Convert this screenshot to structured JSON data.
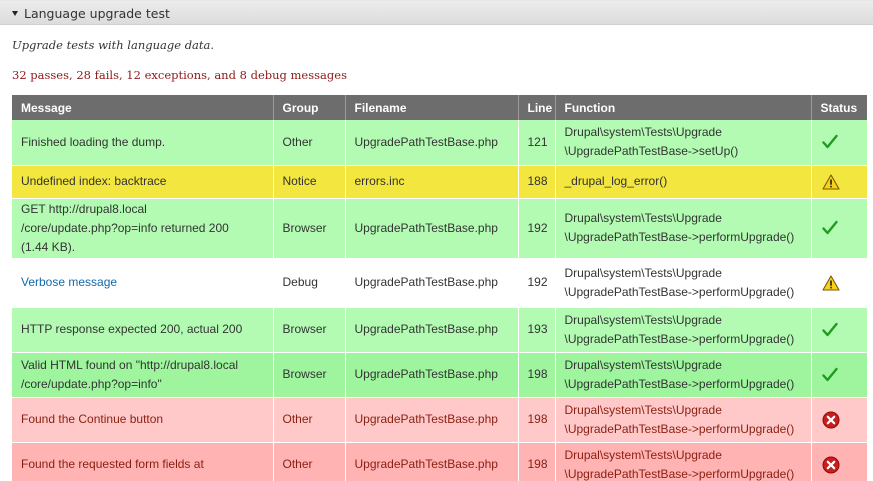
{
  "fieldset": {
    "legend": "Language upgrade test",
    "description": "Upgrade tests with language data.",
    "summary": "32 passes, 28 fails, 12 exceptions, and 8 debug messages"
  },
  "table": {
    "headers": [
      "Message",
      "Group",
      "Filename",
      "Line",
      "Function",
      "Status"
    ],
    "rows": [
      {
        "message": [
          "Finished loading the dump."
        ],
        "group": "Other",
        "filename": "UpgradePathTestBase.php",
        "line": "121",
        "function": [
          "Drupal\\system\\Tests\\Upgrade",
          "\\UpgradePathTestBase->setUp()"
        ],
        "status": "pass"
      },
      {
        "message": [
          "Undefined index: backtrace"
        ],
        "group": "Notice",
        "filename": "errors.inc",
        "line": "188",
        "function": [
          "_drupal_log_error()"
        ],
        "status": "exception"
      },
      {
        "message": [
          "GET http://drupal8.local",
          "/core/update.php?op=info returned 200",
          "(1.44 KB)."
        ],
        "group": "Browser",
        "filename": "UpgradePathTestBase.php",
        "line": "192",
        "function": [
          "Drupal\\system\\Tests\\Upgrade",
          "\\UpgradePathTestBase->performUpgrade()"
        ],
        "status": "pass"
      },
      {
        "message": [
          "Verbose message"
        ],
        "group": "Debug",
        "filename": "UpgradePathTestBase.php",
        "line": "192",
        "function": [
          "Drupal\\system\\Tests\\Upgrade",
          "\\UpgradePathTestBase->performUpgrade()"
        ],
        "status": "debug"
      },
      {
        "message": [
          "HTTP response expected 200, actual 200"
        ],
        "group": "Browser",
        "filename": "UpgradePathTestBase.php",
        "line": "193",
        "function": [
          "Drupal\\system\\Tests\\Upgrade",
          "\\UpgradePathTestBase->performUpgrade()"
        ],
        "status": "pass"
      },
      {
        "message": [
          "Valid HTML found on \"http://drupal8.local",
          "/core/update.php?op=info\""
        ],
        "group": "Browser",
        "filename": "UpgradePathTestBase.php",
        "line": "198",
        "function": [
          "Drupal\\system\\Tests\\Upgrade",
          "\\UpgradePathTestBase->performUpgrade()"
        ],
        "status": "pass"
      },
      {
        "message": [
          "Found the Continue button"
        ],
        "group": "Other",
        "filename": "UpgradePathTestBase.php",
        "line": "198",
        "function": [
          "Drupal\\system\\Tests\\Upgrade",
          "\\UpgradePathTestBase->performUpgrade()"
        ],
        "status": "fail"
      },
      {
        "message": [
          "Found the requested form fields at"
        ],
        "group": "Other",
        "filename": "UpgradePathTestBase.php",
        "line": "198",
        "function": [
          "Drupal\\system\\Tests\\Upgrade",
          "\\UpgradePathTestBase->performUpgrade()"
        ],
        "status": "fail"
      }
    ]
  },
  "icons": {
    "pass": "check-icon",
    "exception": "warning-icon",
    "debug": "warning-icon",
    "fail": "error-icon"
  },
  "colors": {
    "pass_row": "#b3fbb3",
    "notice_row": "#f3e63e",
    "fail_row": "#ffc9c9",
    "header_bg": "#6d6d6d",
    "summary_text": "#8c1a1a",
    "link": "#0f6bab"
  }
}
